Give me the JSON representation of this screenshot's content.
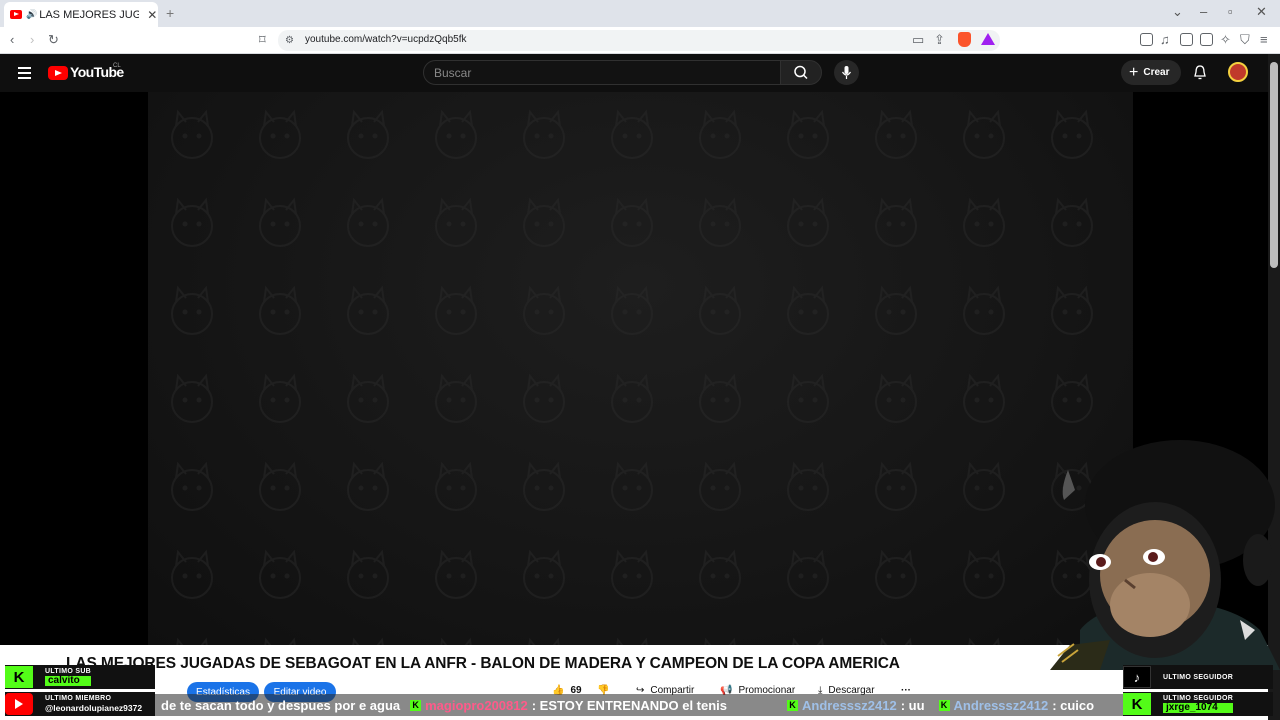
{
  "browser": {
    "tab_title": "LAS MEJORES JUGAD/",
    "url": "youtube.com/watch?v=ucpdzQqb5fk"
  },
  "youtube": {
    "logo_text": "YouTube",
    "region": "CL",
    "search_placeholder": "Buscar",
    "create_label": "Crear"
  },
  "video": {
    "title": "LAS MEJORES JUGADAS DE SEBAGOAT EN LA ANFR - BALON DE MADERA Y CAMPEON DE LA COPA AMERICA",
    "buttons": {
      "stats": "Estadísticas",
      "edit": "Editar video"
    },
    "likes": "69",
    "actions": {
      "share": "Compartir",
      "promote": "Promocionar",
      "download": "Descargar"
    }
  },
  "overlay": {
    "last_sub_label": "ULTIMO SUB",
    "last_sub_name": "calvito",
    "last_member_label": "ULTIMO MIEMBRO",
    "last_member_name": "@leonardolupianez9372",
    "last_follower_label_tiktok": "ULTIMO SEGUIDOR",
    "last_follower_label_kick": "ULTIMO SEGUIDOR",
    "last_follower_name": "jxrge_1074",
    "ticker": {
      "msg1": "de te sacan todo y despues por e agua",
      "user2": "magiopro200812",
      "msg2": ": ESTOY ENTRENANDO el tenis",
      "user3": "Andresssz2412",
      "msg3": ": uu",
      "user4": "Andresssz2412",
      "msg4": ": cuico"
    }
  },
  "colors": {
    "youtube_red": "#ff0000",
    "kick_green": "#53fc18",
    "button_blue": "#1a73e8"
  }
}
